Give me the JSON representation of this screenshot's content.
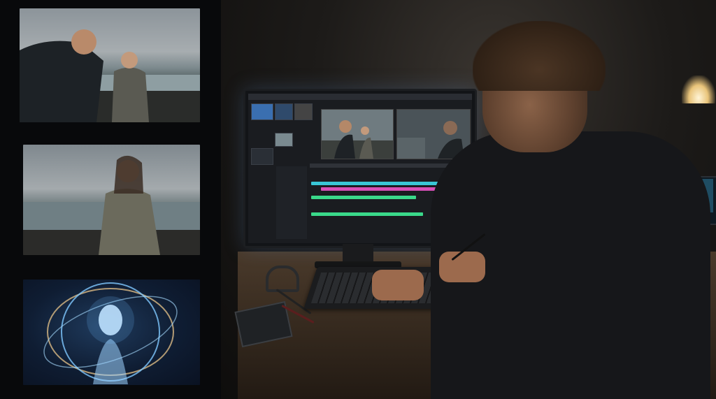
{
  "scene": {
    "accent_colors": {
      "screen_glow": "#5a8cc8",
      "track_cyan": "#39c6d6",
      "track_green": "#3ad98a",
      "track_magenta": "#d64fb6",
      "lamp_warm": "#e9c47a"
    }
  },
  "storyboard": {
    "frames": [
      {
        "name": "storyboard-frame-1"
      },
      {
        "name": "storyboard-frame-2"
      },
      {
        "name": "storyboard-frame-3"
      }
    ]
  }
}
